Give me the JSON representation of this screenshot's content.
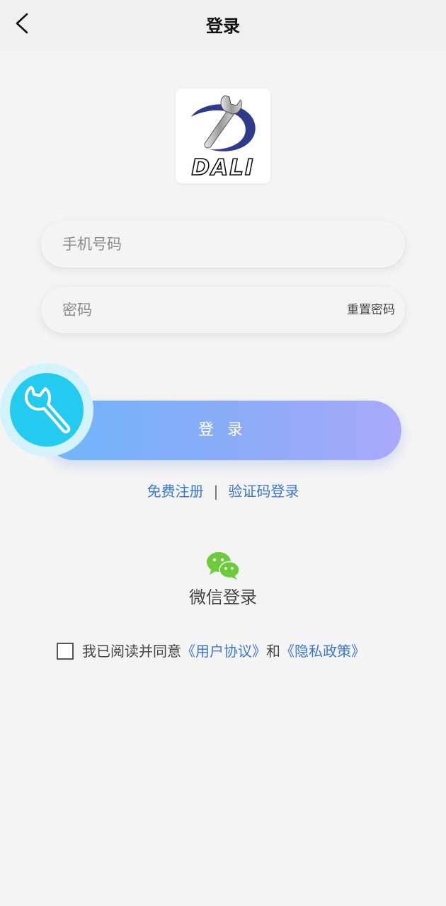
{
  "header": {
    "title": "登录",
    "back_icon": "chevron-left-icon"
  },
  "logo": {
    "text": "DALI",
    "icon": "wrench-logo"
  },
  "form": {
    "phone_placeholder": "手机号码",
    "password_placeholder": "密码",
    "reset_password_label": "重置密码",
    "login_button_label": "登 录"
  },
  "floating_button": {
    "icon": "wrench-icon"
  },
  "links": {
    "register": "免费注册",
    "separator": "|",
    "code_login": "验证码登录"
  },
  "wechat": {
    "icon": "wechat-icon",
    "label": "微信登录"
  },
  "agreement": {
    "prefix": "我已阅读并同意",
    "user_agreement": "《用户协议》",
    "conjunction": "和",
    "privacy_policy": "《隐私政策》"
  },
  "colors": {
    "link_blue": "#3c78d0",
    "button_gradient_start": "#70b5fb",
    "button_gradient_end": "#a9a9fb",
    "float_button_cyan": "#23cbee",
    "wechat_green": "#6ccb3b"
  }
}
